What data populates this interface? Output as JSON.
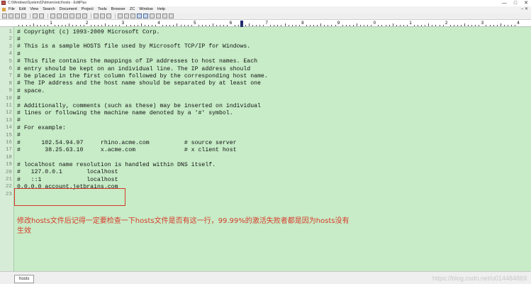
{
  "window": {
    "title": "C:\\Windows\\System32\\drivers\\etc\\hosts - EditPlus",
    "controls": [
      "—",
      "□",
      "✕"
    ]
  },
  "menu": {
    "items": [
      "File",
      "Edit",
      "View",
      "Search",
      "Document",
      "Project",
      "Tools",
      "Browser",
      "ZC",
      "Window",
      "Help"
    ],
    "close": "– ✕"
  },
  "ruler": {
    "marks": [
      "1",
      "2",
      "3",
      "4",
      "5",
      "6",
      "7",
      "8",
      "9",
      "0",
      "1",
      "2",
      "3",
      "4"
    ]
  },
  "editor": {
    "lines": [
      {
        "n": "1",
        "text": "# Copyright (c) 1993-2009 Microsoft Corp."
      },
      {
        "n": "2",
        "text": "#"
      },
      {
        "n": "3",
        "text": "# This is a sample HOSTS file used by Microsoft TCP/IP for Windows."
      },
      {
        "n": "4",
        "text": "#"
      },
      {
        "n": "5",
        "text": "# This file contains the mappings of IP addresses to host names. Each"
      },
      {
        "n": "6",
        "text": "# entry should be kept on an individual line. The IP address should"
      },
      {
        "n": "7",
        "text": "# be placed in the first column followed by the corresponding host name."
      },
      {
        "n": "8",
        "text": "# The IP address and the host name should be separated by at least one"
      },
      {
        "n": "9",
        "text": "# space."
      },
      {
        "n": "10",
        "text": "#"
      },
      {
        "n": "11",
        "text": "# Additionally, comments (such as these) may be inserted on individual"
      },
      {
        "n": "12",
        "text": "# lines or following the machine name denoted by a '#' symbol."
      },
      {
        "n": "13",
        "text": "#"
      },
      {
        "n": "14",
        "text": "# For example:"
      },
      {
        "n": "15",
        "text": "#"
      },
      {
        "n": "16",
        "text": "#      102.54.94.97     rhino.acme.com          # source server"
      },
      {
        "n": "17",
        "text": "#       38.25.63.10     x.acme.com              # x client host"
      },
      {
        "n": "18",
        "text": ""
      },
      {
        "n": "19",
        "text": "# localhost name resolution is handled within DNS itself."
      },
      {
        "n": "20",
        "text": "#   127.0.0.1       localhost"
      },
      {
        "n": "21",
        "text": "#   ::1             localhost"
      },
      {
        "n": "22",
        "text": "0.0.0.0 account.jetbrains.com"
      },
      {
        "n": "23",
        "text": ""
      }
    ]
  },
  "annotation": {
    "text": "修改hosts文件后记得一定要检查一下hosts文件是否有这一行，99.99%的激活失败者都是因为hosts没有生效"
  },
  "statusbar": {
    "tab_label": "hosts",
    "watermark": "https://blog.csdn.net/u014484869"
  }
}
